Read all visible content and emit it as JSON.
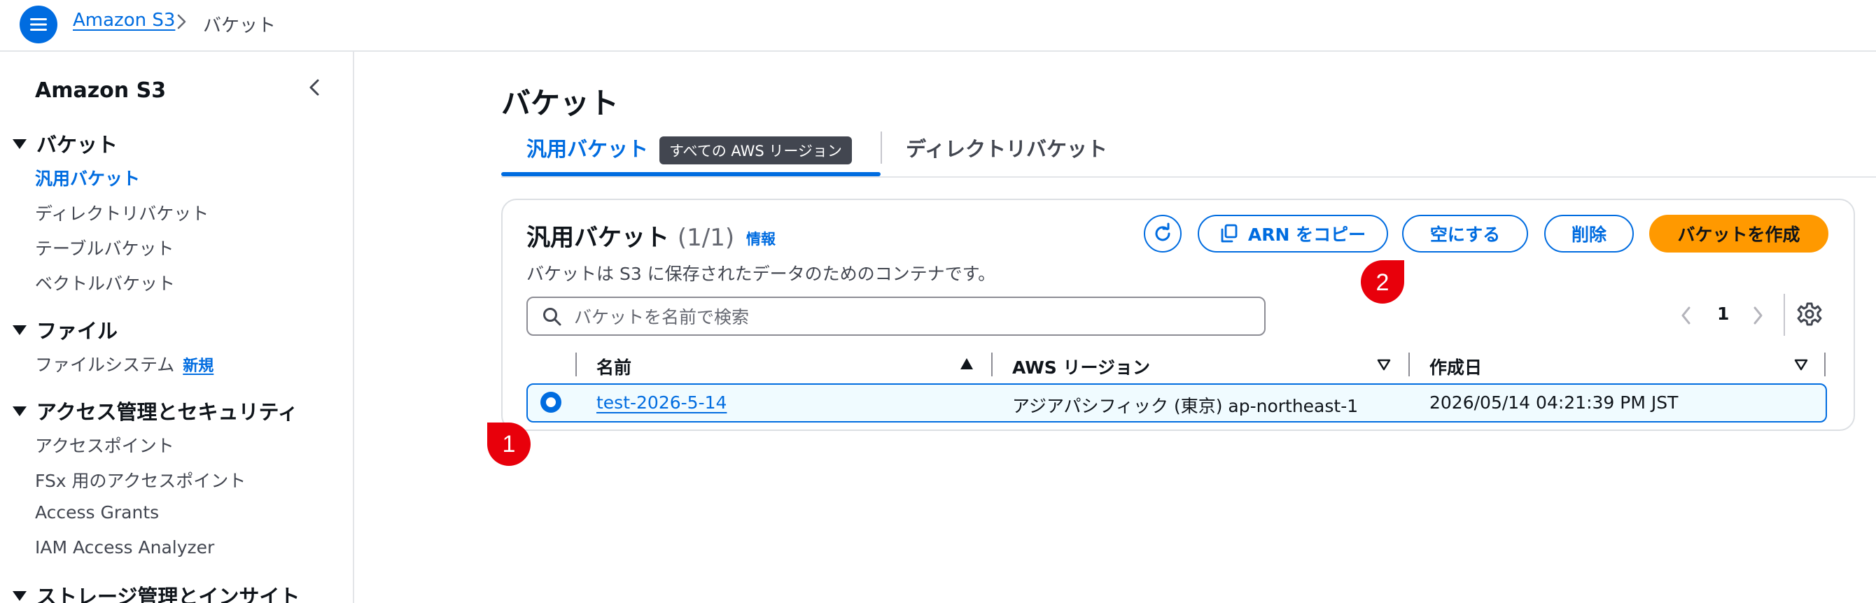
{
  "breadcrumb": {
    "service": "Amazon S3",
    "current": "バケット"
  },
  "sidebar": {
    "title": "Amazon S3",
    "sections": [
      {
        "label": "バケット",
        "items": [
          "汎用バケット",
          "ディレクトリバケット",
          "テーブルバケット",
          "ベクトルバケット"
        ]
      },
      {
        "label": "ファイル",
        "items": [
          "ファイルシステム"
        ],
        "new_badge": "新規"
      },
      {
        "label": "アクセス管理とセキュリティ",
        "items": [
          "アクセスポイント",
          "FSx 用のアクセスポイント",
          "Access Grants",
          "IAM Access Analyzer"
        ]
      },
      {
        "label": "ストレージ管理とインサイト",
        "items": []
      }
    ],
    "active_item": "汎用バケット"
  },
  "main": {
    "title": "バケット",
    "tabs": [
      {
        "label": "汎用バケット",
        "badge": "すべての AWS リージョン",
        "selected": true
      },
      {
        "label": "ディレクトリバケット",
        "selected": false
      }
    ],
    "panel": {
      "title": "汎用バケット",
      "count": "(1/1)",
      "info": "情報",
      "description": "バケットは S3 に保存されたデータのためのコンテナです。",
      "buttons": {
        "copy_arn": "ARN をコピー",
        "empty": "空にする",
        "delete": "削除",
        "create": "バケットを作成"
      },
      "search_placeholder": "バケットを名前で検索",
      "page": "1",
      "columns": [
        "名前",
        "AWS リージョン",
        "作成日"
      ],
      "rows": [
        {
          "name": "test-2026-5-14",
          "region": "アジアパシフィック (東京) ap-northeast-1",
          "created": "2026/05/14 04:21:39 PM JST",
          "selected": true
        }
      ]
    }
  },
  "annotations": [
    "1",
    "2"
  ],
  "colors": {
    "accent": "#006ce0",
    "primary_button": "#ff9900",
    "marker": "#e8000b"
  }
}
